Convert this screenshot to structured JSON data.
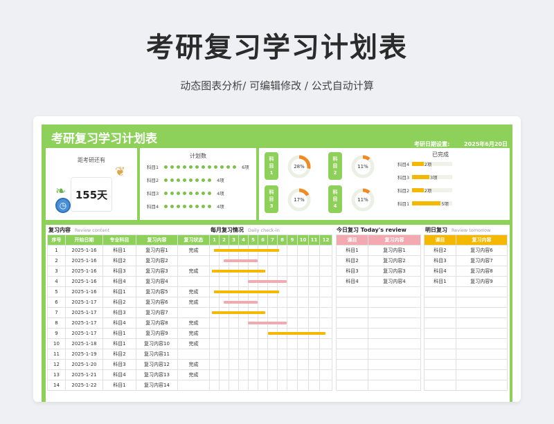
{
  "page": {
    "title": "考研复习学习计划表",
    "subtitle": "动态图表分析/  可编辑修改  / 公式自动计算"
  },
  "sheet": {
    "title": "考研复习学习计划表",
    "exam_date_label": "考研日期设置:",
    "exam_date": "2025年6月20日",
    "countdown_label": "距考研还有",
    "countdown_value": "155天"
  },
  "plan": {
    "title": "计划数",
    "rows": [
      {
        "label": "科目1",
        "dots": 12,
        "count": "6项"
      },
      {
        "label": "科目2",
        "dots": 8,
        "count": "4项"
      },
      {
        "label": "科目3",
        "dots": 8,
        "count": "4项"
      },
      {
        "label": "科目4",
        "dots": 8,
        "count": "4项"
      }
    ]
  },
  "progress": [
    {
      "subject": [
        "科",
        "目",
        "1"
      ],
      "percent": 28,
      "label": "28%"
    },
    {
      "subject": [
        "科",
        "目",
        "2"
      ],
      "percent": 11,
      "label": "11%"
    },
    {
      "subject": [
        "科",
        "目",
        "3"
      ],
      "percent": 17,
      "label": "17%"
    },
    {
      "subject": [
        "科",
        "目",
        "4"
      ],
      "percent": 11,
      "label": "11%"
    }
  ],
  "completed": {
    "title": "已完成",
    "rows": [
      {
        "label": "科目4",
        "value": 2,
        "count": "2项"
      },
      {
        "label": "科目3",
        "value": 3,
        "count": "3项"
      },
      {
        "label": "科目2",
        "value": 2,
        "count": "2项"
      },
      {
        "label": "科目1",
        "value": 5,
        "count": "5项"
      }
    ],
    "max": 6
  },
  "review": {
    "title": "复习内容",
    "title_en": "Review content",
    "headers": [
      "序号",
      "开始日期",
      "专业科目",
      "复习内容",
      "复习状态"
    ],
    "rows": [
      {
        "no": "1",
        "date": "2025-1-16",
        "subject": "科目1",
        "content": "复习内容1",
        "status": "完成"
      },
      {
        "no": "2",
        "date": "2025-1-16",
        "subject": "科目2",
        "content": "复习内容2",
        "status": ""
      },
      {
        "no": "3",
        "date": "2025-1-16",
        "subject": "科目3",
        "content": "复习内容3",
        "status": "完成"
      },
      {
        "no": "4",
        "date": "2025-1-16",
        "subject": "科目4",
        "content": "复习内容4",
        "status": ""
      },
      {
        "no": "5",
        "date": "2025-1-16",
        "subject": "科目1",
        "content": "复习内容5",
        "status": "完成"
      },
      {
        "no": "6",
        "date": "2025-1-17",
        "subject": "科目2",
        "content": "复习内容6",
        "status": "完成"
      },
      {
        "no": "7",
        "date": "2025-1-17",
        "subject": "科目3",
        "content": "复习内容7",
        "status": ""
      },
      {
        "no": "8",
        "date": "2025-1-17",
        "subject": "科目4",
        "content": "复习内容8",
        "status": "完成"
      },
      {
        "no": "9",
        "date": "2025-1-17",
        "subject": "科目1",
        "content": "复习内容9",
        "status": "完成"
      },
      {
        "no": "10",
        "date": "2025-1-18",
        "subject": "科目1",
        "content": "复习内容10",
        "status": "完成"
      },
      {
        "no": "11",
        "date": "2025-1-19",
        "subject": "科目2",
        "content": "复习内容11",
        "status": ""
      },
      {
        "no": "12",
        "date": "2025-1-20",
        "subject": "科目3",
        "content": "复习内容12",
        "status": "完成"
      },
      {
        "no": "13",
        "date": "2025-1-21",
        "subject": "科目4",
        "content": "复习内容13",
        "status": "完成"
      },
      {
        "no": "14",
        "date": "2025-1-22",
        "subject": "科目1",
        "content": "复习内容14",
        "status": ""
      }
    ]
  },
  "monthly": {
    "title": "每月复习情况",
    "title_en": "Daily check-in",
    "months": [
      "1",
      "2",
      "3",
      "4",
      "5",
      "6",
      "7",
      "8",
      "9",
      "10",
      "11",
      "12"
    ],
    "bars": [
      {
        "row": 0,
        "start": 1.5,
        "end": 8.2,
        "color": "#f5b800"
      },
      {
        "row": 1,
        "start": 2.5,
        "end": 6.0,
        "color": "#f3a9b0"
      },
      {
        "row": 2,
        "start": 1.3,
        "end": 6.8,
        "color": "#f5b800"
      },
      {
        "row": 3,
        "start": 5.0,
        "end": 9.0,
        "color": "#f3a9b0"
      },
      {
        "row": 4,
        "start": 1.5,
        "end": 8.2,
        "color": "#f5b800"
      },
      {
        "row": 5,
        "start": 2.5,
        "end": 6.0,
        "color": "#f3a9b0"
      },
      {
        "row": 6,
        "start": 1.3,
        "end": 6.8,
        "color": "#f5b800"
      },
      {
        "row": 7,
        "start": 5.0,
        "end": 9.0,
        "color": "#f3a9b0"
      },
      {
        "row": 8,
        "start": 7.1,
        "end": 12.5,
        "color": "#f5b800"
      }
    ]
  },
  "today": {
    "title": "今日复习 Today's review",
    "headers": [
      "课目",
      "复习内容"
    ],
    "rows": [
      {
        "subject": "科目1",
        "content": "复习内容1"
      },
      {
        "subject": "科目2",
        "content": "复习内容2"
      },
      {
        "subject": "科目3",
        "content": "复习内容3"
      },
      {
        "subject": "科目4",
        "content": "复习内容4"
      }
    ]
  },
  "tomorrow": {
    "title": "明日复习",
    "title_en": "Review tomorrow",
    "headers": [
      "课目",
      "复习内容"
    ],
    "rows": [
      {
        "subject": "科目2",
        "content": "复习内容6"
      },
      {
        "subject": "科目3",
        "content": "复习内容7"
      },
      {
        "subject": "科目4",
        "content": "复习内容8"
      },
      {
        "subject": "科目1",
        "content": "复习内容9"
      }
    ]
  },
  "colors": {
    "green": "#8ed15a",
    "orange": "#f5b800",
    "pink": "#f3a9b0",
    "donut": "#f08a24"
  }
}
